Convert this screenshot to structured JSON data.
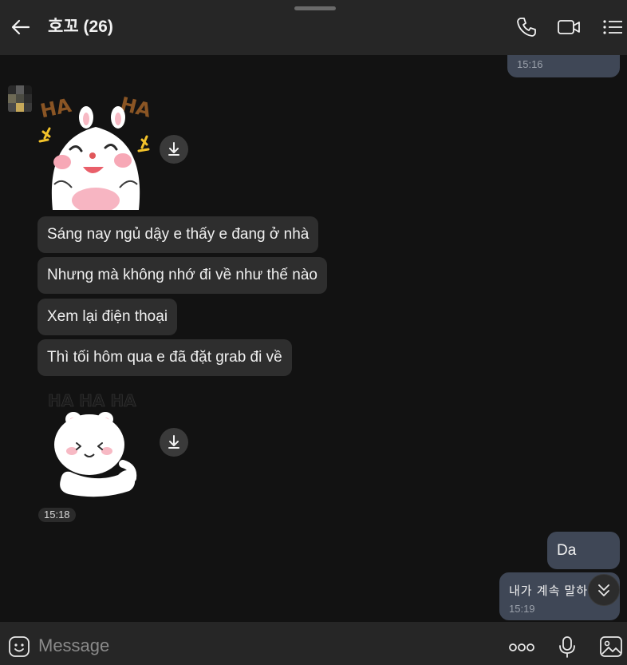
{
  "header": {
    "title": "호꼬 (26)",
    "back_icon": "arrow-left-icon",
    "call_icon": "phone-icon",
    "video_icon": "video-camera-icon",
    "menu_icon": "menu-icon"
  },
  "messages": {
    "top_prev_time": "15:16",
    "incoming": [
      "Sáng nay ngủ dậy e thấy e đang ở nhà",
      "Nhưng mà không nhớ đi về như thế nào",
      "Xem lại điện thoại",
      "Thì tối hôm qua e đã đặt grab đi về"
    ],
    "sticker1_text_left": "HA",
    "sticker1_text_right": "HA",
    "sticker2_text": "HA HA HA",
    "incoming_time": "15:18",
    "outgoing_1": "Da",
    "outgoing_2": "내가 계속 말하",
    "outgoing_2_time": "15:19"
  },
  "composer": {
    "placeholder": "Message"
  },
  "colors": {
    "background": "#121212",
    "header": "#262626",
    "incoming_bubble": "#2e2e2e",
    "outgoing_bubble": "#3f4756"
  }
}
